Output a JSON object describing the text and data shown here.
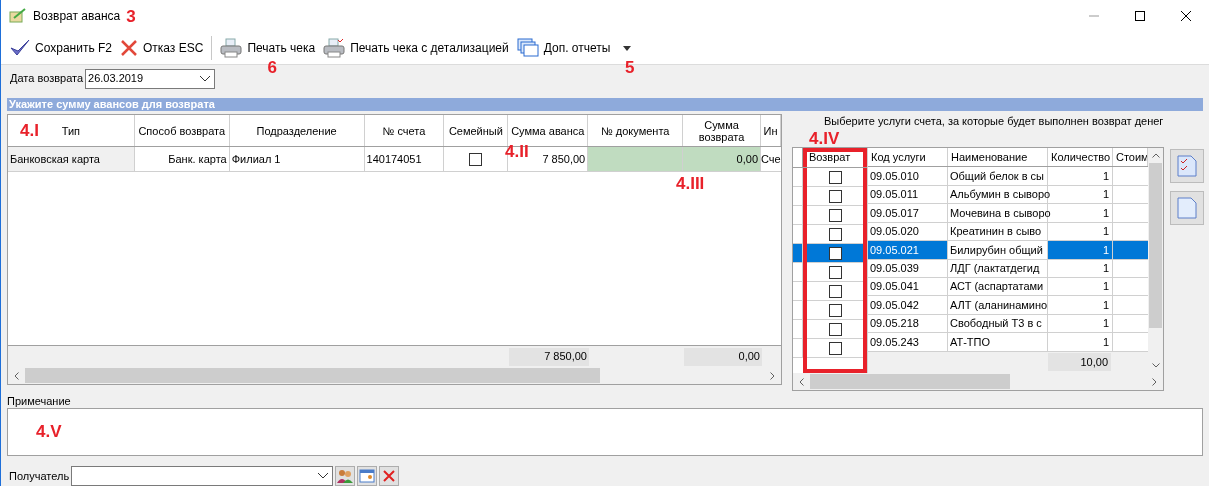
{
  "window": {
    "title": "Возврат аванса",
    "annotation": "3"
  },
  "toolbar": [
    {
      "kind": "save",
      "label": "Сохранить F2"
    },
    {
      "kind": "cancel",
      "label": "Отказ ESC"
    },
    {
      "kind": "print",
      "label": "Печать чека",
      "annotation": "6"
    },
    {
      "kind": "print-detail",
      "label": "Печать чека с детализацией"
    },
    {
      "kind": "reports",
      "label": "Доп. отчеты",
      "annotation": "5"
    }
  ],
  "return_date": {
    "label": "Дата возврата",
    "value": "26.03.2019"
  },
  "section_header": "Укажите сумму авансов для возврата",
  "advances": {
    "annotations": [
      "4.I",
      "4.II",
      "4.III"
    ],
    "columns": [
      "Тип",
      "Способ возврата",
      "Подразделение",
      "№ счета",
      "Семейный",
      "Сумма аванса",
      "№ документа",
      "Сумма возврата",
      "Ин"
    ],
    "rows": [
      {
        "type": "Банковская карта",
        "method": "Банк. карта",
        "branch": "Филиал 1",
        "account": "140174051",
        "family": false,
        "advance": "7 850,00",
        "document": "",
        "refund": "0,00",
        "extra": "Сче"
      }
    ],
    "totals": {
      "advance": "7 850,00",
      "refund": "0,00"
    }
  },
  "services": {
    "caption": "Выберите услуги счета, за которые будет выполнен возврат денег",
    "annotation": "4.IV",
    "columns": [
      "Возврат",
      "Код услуги",
      "Наименование",
      "Количество",
      "Стоим"
    ],
    "rows": [
      {
        "checked": false,
        "selected": false,
        "code": "09.05.010",
        "name": "Общий белок в сы",
        "qty": "1"
      },
      {
        "checked": false,
        "selected": false,
        "code": "09.05.011",
        "name": "Альбумин в сыворо",
        "qty": "1"
      },
      {
        "checked": false,
        "selected": false,
        "code": "09.05.017",
        "name": "Мочевина в сыворо",
        "qty": "1"
      },
      {
        "checked": false,
        "selected": false,
        "code": "09.05.020",
        "name": "Креатинин в сыво",
        "qty": "1"
      },
      {
        "checked": false,
        "selected": true,
        "code": "09.05.021",
        "name": "Билирубин общий",
        "qty": "1"
      },
      {
        "checked": false,
        "selected": false,
        "code": "09.05.039",
        "name": "ЛДГ (лактатдегид",
        "qty": "1"
      },
      {
        "checked": false,
        "selected": false,
        "code": "09.05.041",
        "name": "АСТ (аспартатами",
        "qty": "1"
      },
      {
        "checked": false,
        "selected": false,
        "code": "09.05.042",
        "name": "АЛТ (аланинамино",
        "qty": "1"
      },
      {
        "checked": false,
        "selected": false,
        "code": "09.05.218",
        "name": "Свободный Т3 в с",
        "qty": "1"
      },
      {
        "checked": false,
        "selected": false,
        "code": "09.05.243",
        "name": "АТ-ТПО",
        "qty": "1"
      }
    ],
    "totals": {
      "qty": "10,00"
    }
  },
  "note": {
    "label": "Примечание",
    "annotation": "4.V"
  },
  "recipient": {
    "label": "Получатель"
  }
}
